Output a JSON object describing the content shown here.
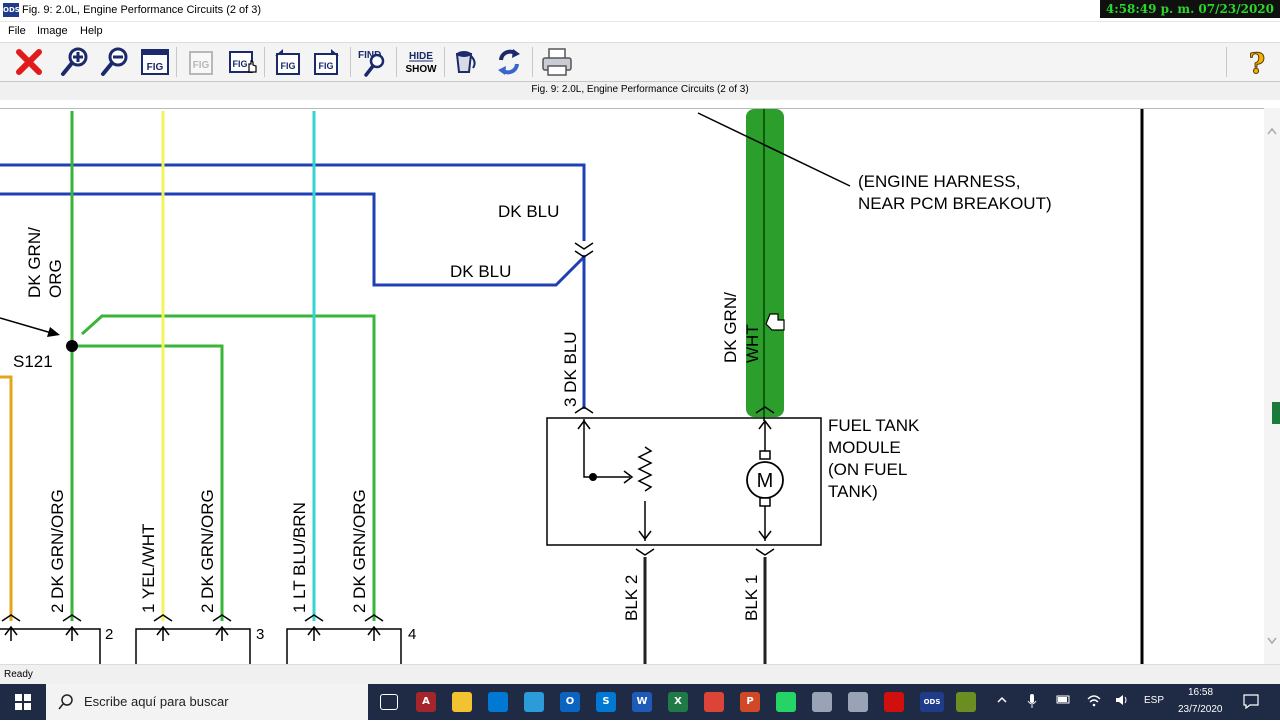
{
  "window": {
    "title": "Fig. 9: 2.0L, Engine Performance Circuits (2 of 3)",
    "clock": "4:58:49 p. m. 07/23/2020",
    "app_icon_label": "ODS"
  },
  "menu": [
    "File",
    "Image",
    "Help"
  ],
  "toolbar": {
    "buttons": [
      {
        "icon": "close-red-x-icon"
      },
      {
        "icon": "zoom-in-icon"
      },
      {
        "icon": "zoom-out-icon"
      },
      {
        "icon": "fig-icon",
        "label": "FIG"
      },
      {
        "icon": "fig-disabled-icon",
        "label": "FIG"
      },
      {
        "icon": "fig-hand-icon",
        "label": "FIG"
      },
      {
        "icon": "fig-prev-icon",
        "label": "FIG"
      },
      {
        "icon": "fig-next-icon",
        "label": "FIG"
      },
      {
        "icon": "find-icon",
        "label": "FIND"
      },
      {
        "icon": "hide-show-icon",
        "label_top": "HIDE",
        "label_bottom": "SHOW"
      },
      {
        "icon": "paint-bucket-icon"
      },
      {
        "icon": "refresh-icon"
      },
      {
        "icon": "printer-icon"
      },
      {
        "icon": "help-icon",
        "label": "?"
      }
    ]
  },
  "figure_caption": "Fig. 9: 2.0L, Engine Performance Circuits (2 of 3)",
  "diagram": {
    "labels": {
      "dk_blu_1": "DK BLU",
      "dk_blu_2": "DK BLU",
      "dk_blu_3": "3 DK BLU",
      "dk_grn_org_top_line1": "DK GRN/",
      "dk_grn_org_top_line2": "ORG",
      "s121": "S121",
      "engine_harness_line1": "(ENGINE HARNESS,",
      "engine_harness_line2": "NEAR PCM BREAKOUT)",
      "dk_grn_wht_line1": "DK GRN/",
      "dk_grn_wht_line2": "WHT",
      "fuel_tank_line1": "FUEL TANK",
      "fuel_tank_line2": "MODULE",
      "fuel_tank_line3": "(ON FUEL",
      "fuel_tank_line4": "TANK)",
      "motor": "M",
      "blk2": "BLK  2",
      "blk1": "BLK  1",
      "c1_pin2": "2  DK GRN/ORG",
      "c2_pin1": "1  YEL/WHT",
      "c2_pin2": "2  DK GRN/ORG",
      "c3_pin1": "1  LT BLU/BRN",
      "c3_pin2": "2  DK GRN/ORG",
      "conn_num_2": "2",
      "conn_num_3": "3",
      "conn_num_4": "4"
    },
    "colors": {
      "dk_blu": "#1f3fb5",
      "dk_grn": "#39b53a",
      "yel": "#f3f35b",
      "lt_blu": "#35d4d4",
      "orange": "#e5a51a",
      "highlight_green": "#2c9e2c",
      "blk": "#222222"
    }
  },
  "status": "Ready",
  "taskbar": {
    "search_placeholder": "Escribe aquí para buscar",
    "language": "ESP",
    "time": "16:58",
    "date": "23/7/2020",
    "apps": [
      {
        "icon": "task-view-icon"
      },
      {
        "icon": "access-icon",
        "label": "A",
        "color": "#a4262c"
      },
      {
        "icon": "file-explorer-icon",
        "color": "#f2c230"
      },
      {
        "icon": "mail-icon",
        "color": "#0078d4"
      },
      {
        "icon": "mail-alt-icon",
        "color": "#2b9bd9"
      },
      {
        "icon": "outlook-icon",
        "label": "O",
        "color": "#0b64c0"
      },
      {
        "icon": "skype-icon",
        "label": "S",
        "color": "#0078d4"
      },
      {
        "icon": "word-icon",
        "label": "W",
        "color": "#1e5bb8"
      },
      {
        "icon": "excel-icon",
        "label": "X",
        "color": "#1f7a45"
      },
      {
        "icon": "chrome-icon",
        "color": "#db4437"
      },
      {
        "icon": "powerpoint-icon",
        "label": "P",
        "color": "#d24726"
      },
      {
        "icon": "whatsapp-icon",
        "color": "#25d366"
      },
      {
        "icon": "pin-icon",
        "color": "#9aa3b5"
      },
      {
        "icon": "autocad-icon",
        "color": "#9aa3b5"
      },
      {
        "icon": "pdf-icon",
        "color": "#d10f0f"
      },
      {
        "icon": "ods-icon",
        "label": "ODS",
        "color": "#1e3c8a"
      },
      {
        "icon": "app-icon",
        "color": "#6b8e23"
      }
    ]
  }
}
